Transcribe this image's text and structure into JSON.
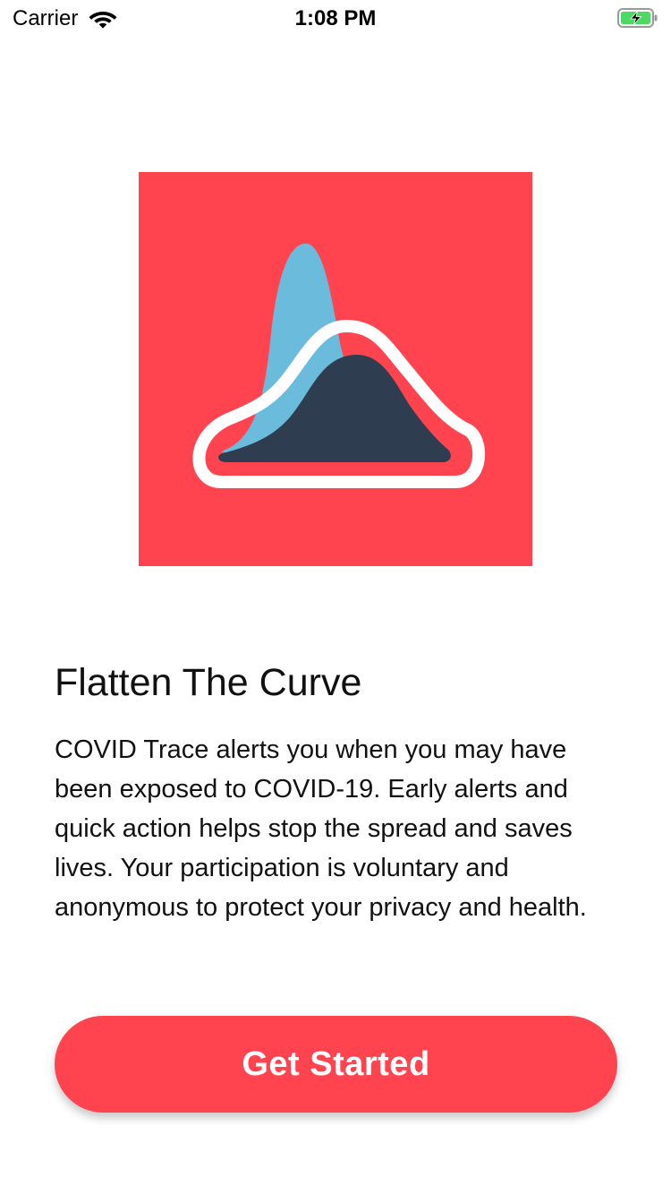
{
  "status_bar": {
    "carrier": "Carrier",
    "time": "1:08 PM",
    "wifi_icon": "wifi-icon",
    "battery_icon": "battery-charging-icon",
    "battery_color": "#4cd964"
  },
  "hero": {
    "background_color": "#ff444f",
    "blue_curve_color": "#6bbbdc",
    "dark_curve_color": "#2e3d50",
    "outline_color": "#ffffff"
  },
  "onboarding": {
    "title": "Flatten The Curve",
    "body": "COVID Trace alerts you when you may have been exposed to COVID-19. Early alerts and quick action helps stop the spread and saves lives. Your participation is voluntary and anonymous to protect your privacy and health.",
    "cta_label": "Get Started",
    "accent_color": "#ff444f"
  }
}
